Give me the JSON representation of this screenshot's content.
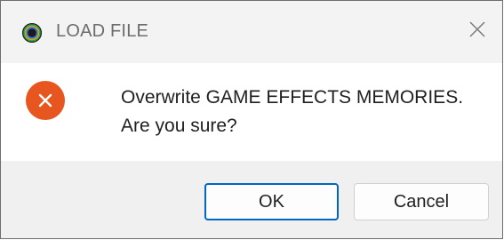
{
  "window": {
    "title": "LOAD FILE",
    "app_icon": "app-logo-icon",
    "close_icon": "close-icon"
  },
  "dialog": {
    "icon": "error-icon",
    "message_line1": "Overwrite GAME EFFECTS MEMORIES.",
    "message_line2": "Are you sure?"
  },
  "buttons": {
    "ok_label": "OK",
    "cancel_label": "Cancel"
  },
  "colors": {
    "error_red": "#e8561f",
    "focus_blue": "#0067c0"
  }
}
